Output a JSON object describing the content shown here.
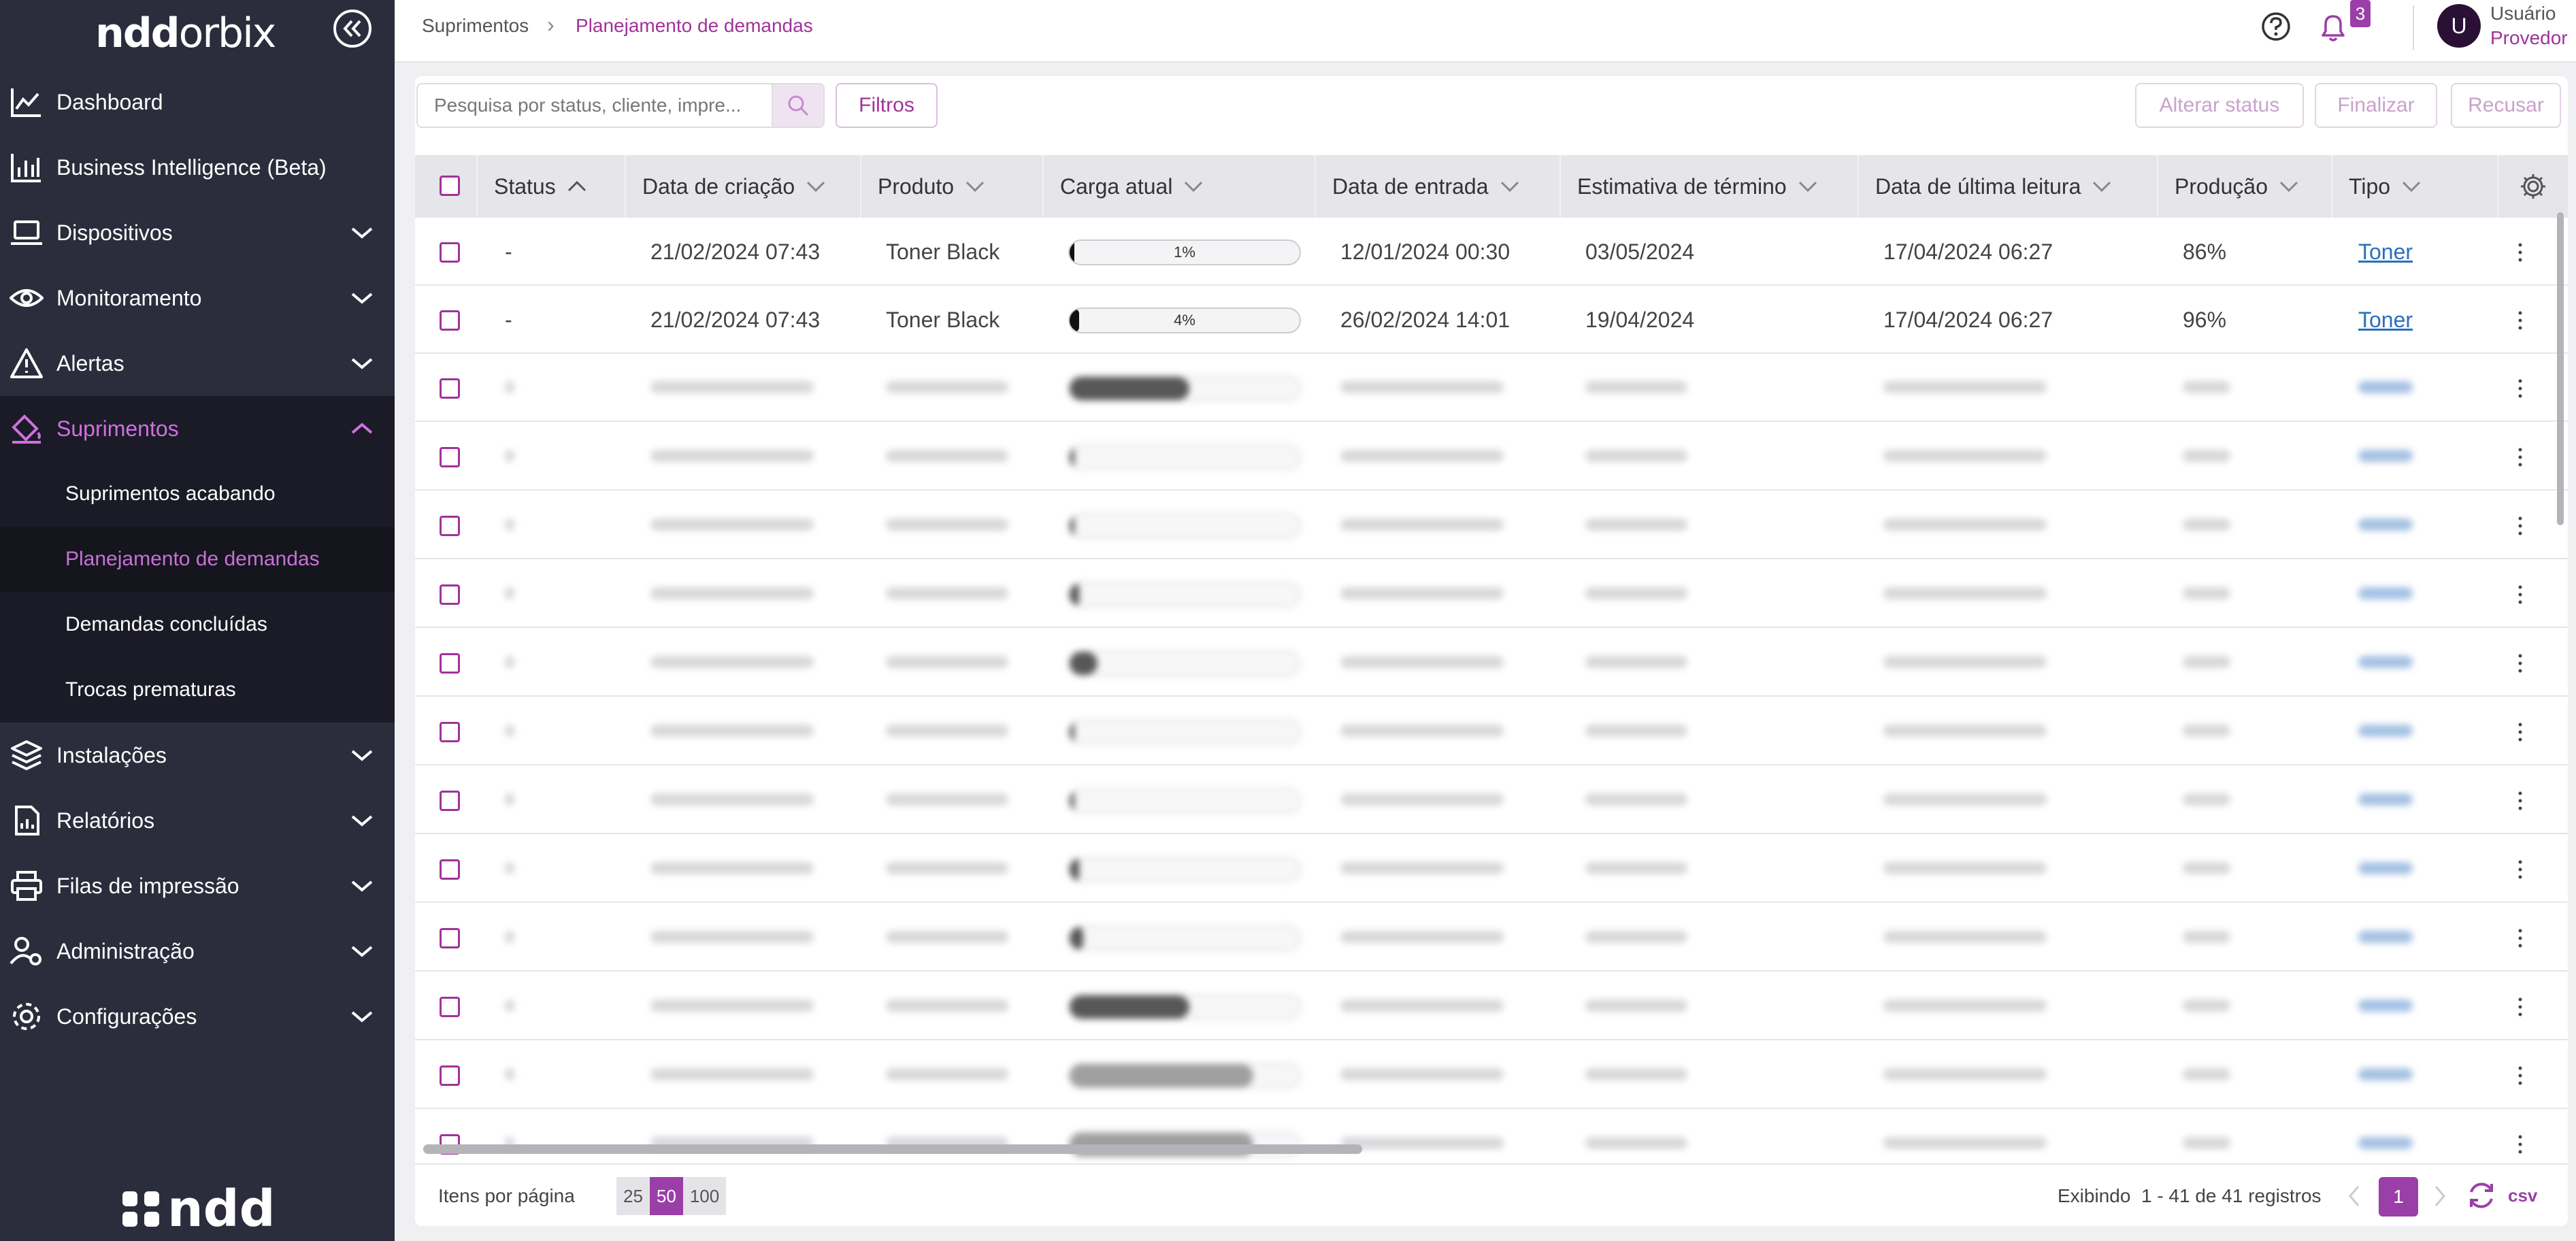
{
  "brand": {
    "logo_bold": "ndd",
    "logo_thin": "orbix",
    "footer_logo": "ndd"
  },
  "colors": {
    "sidebar_bg": "#2b2d3c",
    "accent": "#9b3fa8",
    "link": "#2a6fbe"
  },
  "sidebar": {
    "items": [
      {
        "label": "Dashboard",
        "icon": "chart-line-icon",
        "expandable": false
      },
      {
        "label": "Business Intelligence (Beta)",
        "icon": "bar-chart-icon",
        "expandable": false
      },
      {
        "label": "Dispositivos",
        "icon": "laptop-icon",
        "expandable": true
      },
      {
        "label": "Monitoramento",
        "icon": "eye-icon",
        "expandable": true
      },
      {
        "label": "Alertas",
        "icon": "warning-icon",
        "expandable": true
      },
      {
        "label": "Suprimentos",
        "icon": "paint-bucket-icon",
        "expandable": true,
        "expanded": true
      },
      {
        "label": "Instalações",
        "icon": "layers-icon",
        "expandable": true
      },
      {
        "label": "Relatórios",
        "icon": "report-icon",
        "expandable": true
      },
      {
        "label": "Filas de impressão",
        "icon": "printer-icon",
        "expandable": true
      },
      {
        "label": "Administração",
        "icon": "users-gear-icon",
        "expandable": true
      },
      {
        "label": "Configurações",
        "icon": "gear-icon",
        "expandable": true
      }
    ],
    "subitems": [
      {
        "label": "Suprimentos acabando"
      },
      {
        "label": "Planejamento de demandas",
        "selected": true
      },
      {
        "label": "Demandas concluídas"
      },
      {
        "label": "Trocas prematuras"
      }
    ]
  },
  "header": {
    "breadcrumb": [
      "Suprimentos",
      "Planejamento de demandas"
    ],
    "notification_count": "3",
    "user_initial": "U",
    "user_name": "Usuário",
    "user_role": "Provedor"
  },
  "toolbar": {
    "search_placeholder": "Pesquisa por status, cliente, impre...",
    "filters_label": "Filtros",
    "change_status_label": "Alterar status",
    "finish_label": "Finalizar",
    "refuse_label": "Recusar"
  },
  "table": {
    "columns": [
      "Status",
      "Data de criação",
      "Produto",
      "Carga atual",
      "Data de entrada",
      "Estimativa de término",
      "Data de última leitura",
      "Produção",
      "Tipo"
    ],
    "rows": [
      {
        "status": "-",
        "created": "21/02/2024 07:43",
        "product": "Toner Black",
        "load": "1%",
        "load_value": 1,
        "entry": "12/01/2024 00:30",
        "estimate": "03/05/2024",
        "last_read": "17/04/2024 06:27",
        "production": "86%",
        "type": "Toner"
      },
      {
        "status": "-",
        "created": "21/02/2024 07:43",
        "product": "Toner Black",
        "load": "4%",
        "load_value": 4,
        "entry": "26/02/2024 14:01",
        "estimate": "19/04/2024",
        "last_read": "17/04/2024 06:27",
        "production": "96%",
        "type": "Toner"
      }
    ],
    "blurred_row_count": 12,
    "blurred_row_fills": [
      52,
      2,
      2,
      4,
      12,
      2,
      2,
      4,
      6,
      52,
      80,
      80
    ]
  },
  "footer": {
    "items_per_page_label": "Itens por página",
    "page_sizes": [
      "25",
      "50",
      "100"
    ],
    "selected_page_size": "50",
    "showing_text": "Exibindo  1 - 41 de 41 registros",
    "current_page": "1",
    "csv_label": "csv"
  }
}
